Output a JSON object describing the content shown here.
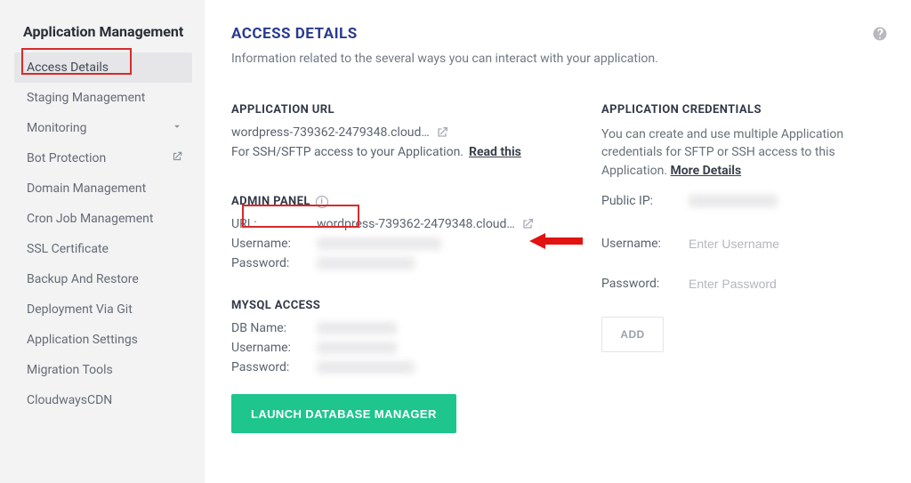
{
  "sidebar": {
    "title": "Application Management",
    "items": [
      {
        "label": "Access Details",
        "active": true
      },
      {
        "label": "Staging Management"
      },
      {
        "label": "Monitoring",
        "caret": true
      },
      {
        "label": "Bot Protection",
        "ext": true
      },
      {
        "label": "Domain Management"
      },
      {
        "label": "Cron Job Management"
      },
      {
        "label": "SSL Certificate"
      },
      {
        "label": "Backup And Restore"
      },
      {
        "label": "Deployment Via Git"
      },
      {
        "label": "Application Settings"
      },
      {
        "label": "Migration Tools"
      },
      {
        "label": "CloudwaysCDN"
      }
    ]
  },
  "header": {
    "title": "ACCESS DETAILS",
    "subtitle": "Information related to the several ways you can interact with your application."
  },
  "app_url": {
    "heading": "APPLICATION URL",
    "url_display": "wordpress-739362-2479348.cloud…",
    "ssh_note_prefix": "For SSH/SFTP access to your Application. ",
    "ssh_note_link": "Read this"
  },
  "admin_panel": {
    "heading": "ADMIN PANEL",
    "url_label": "URL:",
    "url_value": "wordpress-739362-2479348.cloud…",
    "username_label": "Username:",
    "password_label": "Password:"
  },
  "mysql": {
    "heading": "MYSQL ACCESS",
    "dbname_label": "DB Name:",
    "username_label": "Username:",
    "password_label": "Password:",
    "launch_btn": "LAUNCH DATABASE MANAGER"
  },
  "credentials": {
    "heading": "APPLICATION CREDENTIALS",
    "desc_prefix": "You can create and use multiple Application credentials for SFTP or SSH access to this Application. ",
    "desc_link": "More Details",
    "public_ip_label": "Public IP:",
    "username_label": "Username:",
    "password_label": "Password:",
    "username_placeholder": "Enter Username",
    "password_placeholder": "Enter Password",
    "add_btn": "ADD"
  }
}
